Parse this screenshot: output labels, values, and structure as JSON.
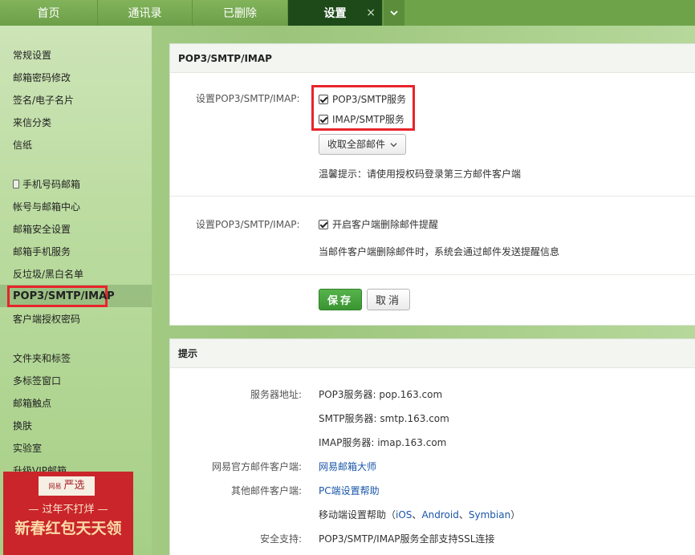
{
  "tabs": {
    "home": "首页",
    "contacts": "通讯录",
    "deleted": "已删除",
    "settings": "设置",
    "close_glyph": "×"
  },
  "sidebar": {
    "group1": [
      "常规设置",
      "邮箱密码修改",
      "签名/电子名片",
      "来信分类",
      "信纸"
    ],
    "group2": [
      "手机号码邮箱",
      "帐号与邮箱中心",
      "邮箱安全设置",
      "邮箱手机服务",
      "反垃圾/黑白名单",
      "POP3/SMTP/IMAP",
      "客户端授权密码"
    ],
    "group3": [
      "文件夹和标签",
      "多标签窗口",
      "邮箱触点",
      "换肤",
      "实验室",
      "升级VIP邮箱"
    ]
  },
  "ad": {
    "brand_small": "网易",
    "brand": "严选",
    "slogan": "— 过年不打烊 —",
    "headline": "新春红包天天领"
  },
  "pop_panel": {
    "title": "POP3/SMTP/IMAP",
    "row1_label": "设置POP3/SMTP/IMAP:",
    "pop3_smtp": "POP3/SMTP服务",
    "imap_smtp": "IMAP/SMTP服务",
    "receive_select": "收取全部邮件",
    "tip": "温馨提示：请使用授权码登录第三方邮件客户端",
    "row2_label": "设置POP3/SMTP/IMAP:",
    "delete_notify": "开启客户端删除邮件提醒",
    "delete_desc": "当邮件客户端删除邮件时，系统会通过邮件发送提醒信息",
    "save": "保存",
    "cancel": "取消"
  },
  "hint_panel": {
    "title": "提示",
    "server_label": "服务器地址:",
    "pop3": "POP3服务器: pop.163.com",
    "smtp": "SMTP服务器: smtp.163.com",
    "imap": "IMAP服务器: imap.163.com",
    "official_label": "网易官方邮件客户端:",
    "official_link": "网易邮箱大师",
    "other_label": "其他邮件客户端:",
    "pc_help": "PC端设置帮助",
    "mobile_prefix": "移动端设置帮助（",
    "ios": "iOS",
    "sep1": "、",
    "android": "Android",
    "sep2": "、",
    "symbian": "Symbian",
    "mobile_suffix": "）",
    "security_label": "安全支持:",
    "security_text": "POP3/SMTP/IMAP服务全部支持SSL连接"
  },
  "colors": {
    "accent_green": "#3a9532",
    "highlight_red": "#e8242b",
    "link_blue": "#1a56a8"
  }
}
